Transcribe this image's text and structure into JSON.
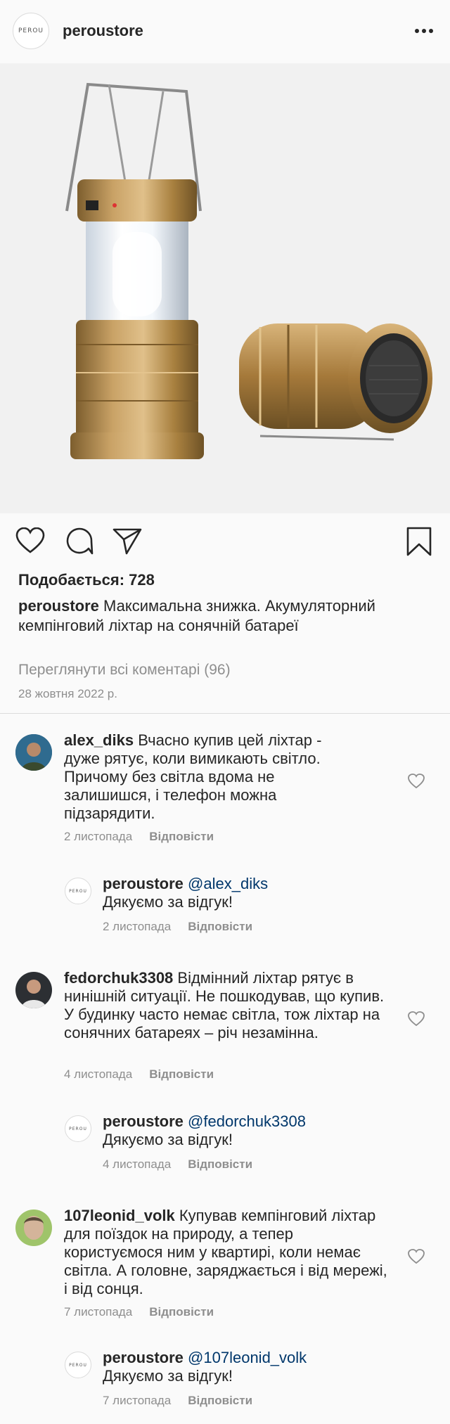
{
  "header": {
    "avatar_text": "PEROU",
    "username": "peroustore"
  },
  "post": {
    "likes": "Подобається: 728",
    "caption_user": "peroustore",
    "caption_text": " Максимальна знижка. Акумуляторний кемпінговий ліхтар на сонячній батареї",
    "view_all": "Переглянути всі коментарі (96)",
    "date": "28 жовтня 2022 р."
  },
  "comments": [
    {
      "user": "alex_diks",
      "text": " Вчасно купив цей ліхтар - дуже рятує, коли вимикають світло. Причому без світла вдома не залишишся, і телефон можна підзарядити.",
      "date": "2 листопада",
      "reply_label": "Відповісти"
    },
    {
      "user": "peroustore",
      "mention": "@alex_diks",
      "text": "Дякуємо за відгук!",
      "date": "2 листопада",
      "reply_label": "Відповісти"
    },
    {
      "user": "fedorchuk3308",
      "text": " Відмінний ліхтар рятує в нинішній ситуації. Не пошкодував, що купив. У будинку часто немає світла, тож ліхтар на сонячних батареях – річ незамінна.",
      "date": "4 листопада",
      "reply_label": "Відповісти"
    },
    {
      "user": "peroustore",
      "mention": "@fedorchuk3308",
      "text": "Дякуємо за відгук!",
      "date": "4 листопада",
      "reply_label": "Відповісти"
    },
    {
      "user": "107leonid_volk",
      "text": " Купував кемпінговий ліхтар для поїздок на природу, а тепер користуємося ним у квартирі, коли немає світла. А головне, заряджається і від мережі, і від сонця.",
      "date": "7 листопада",
      "reply_label": "Відповісти"
    },
    {
      "user": "peroustore",
      "mention": "@107leonid_volk",
      "text": "Дякуємо за відгук!",
      "date": "7 листопада",
      "reply_label": "Відповісти"
    }
  ],
  "icons": [
    "more-icon",
    "heart-icon",
    "comment-icon",
    "share-icon",
    "bookmark-icon"
  ],
  "colors": {
    "gold": "#b08a4f",
    "meta": "#8e8e8e",
    "link": "#00376b"
  }
}
